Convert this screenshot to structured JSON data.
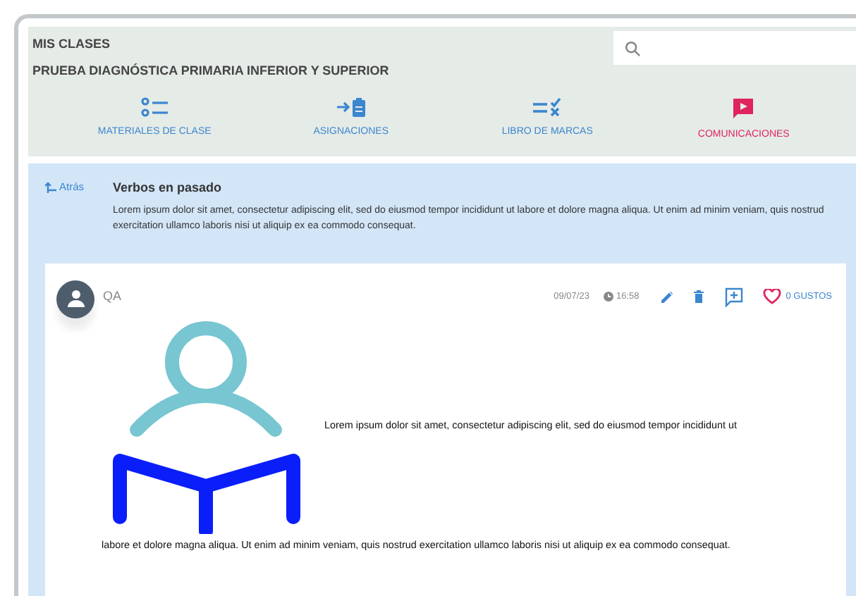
{
  "header": {
    "breadcrumb": "MIS CLASES",
    "course": "PRUEBA DIAGNÓSTICA PRIMARIA INFERIOR Y SUPERIOR"
  },
  "nav": [
    {
      "label": "MATERIALES DE CLASE",
      "kind": "materials",
      "selected": false
    },
    {
      "label": "ASIGNACIONES",
      "kind": "assignments",
      "selected": false
    },
    {
      "label": "LIBRO DE MARCAS",
      "kind": "gradebook",
      "selected": false
    },
    {
      "label": "COMUNICACIONES",
      "kind": "communications",
      "selected": true
    }
  ],
  "topic": {
    "back": "Atrás",
    "title": "Verbos en pasado",
    "description": "Lorem ipsum dolor sit amet, consectetur adipiscing elit, sed do eiusmod tempor incididunt ut labore et dolore magna aliqua. Ut enim ad minim veniam, quis nostrud exercitation ullamco laboris nisi ut aliquip ex ea commodo consequat."
  },
  "post": {
    "author": "QA",
    "date": "09/07/23",
    "time": "16:58",
    "likes": "0 GUSTOS",
    "liked": false,
    "text_beside_image": "Lorem ipsum dolor sit amet, consectetur adipiscing elit, sed do eiusmod tempor incididunt ut",
    "text_below_image": "labore et dolore magna aliqua. Ut enim ad minim veniam, quis nostrud exercitation ullamco laboris nisi ut aliquip ex ea commodo consequat."
  }
}
